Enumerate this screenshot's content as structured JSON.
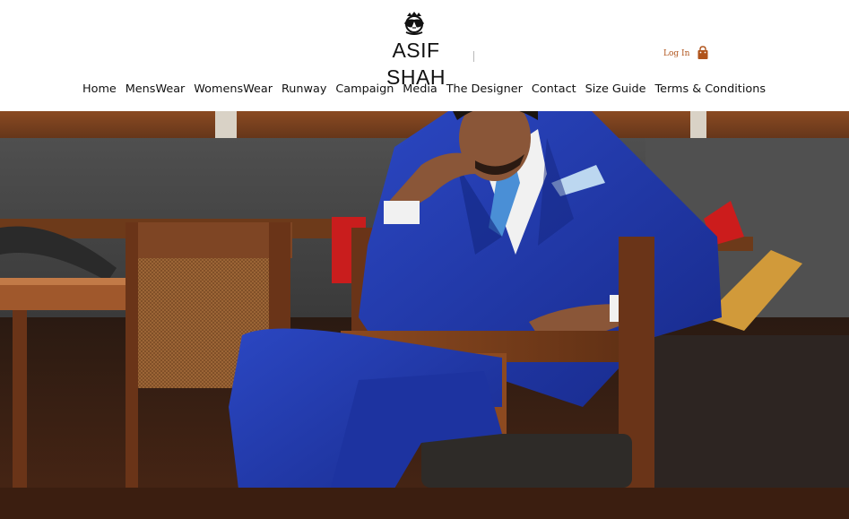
{
  "header": {
    "brand": "ASIF SHAH",
    "logo_icon": "crest-emblem-icon",
    "login_label": "Log In",
    "cart_icon": "shopping-bag-icon",
    "accent_color": "#b0541c"
  },
  "nav": {
    "items": [
      {
        "label": "Home"
      },
      {
        "label": "MensWear"
      },
      {
        "label": "WomensWear"
      },
      {
        "label": "Runway"
      },
      {
        "label": "Campaign"
      },
      {
        "label": "Media"
      },
      {
        "label": "The Designer"
      },
      {
        "label": "Contact"
      },
      {
        "label": "Size Guide"
      },
      {
        "label": "Terms & Conditions"
      }
    ]
  },
  "hero": {
    "image_subject": "hero-photo",
    "colors": {
      "suit": "#1f3aa8",
      "wood": "#7a3f1c",
      "wall": "#4b4b4b"
    }
  }
}
